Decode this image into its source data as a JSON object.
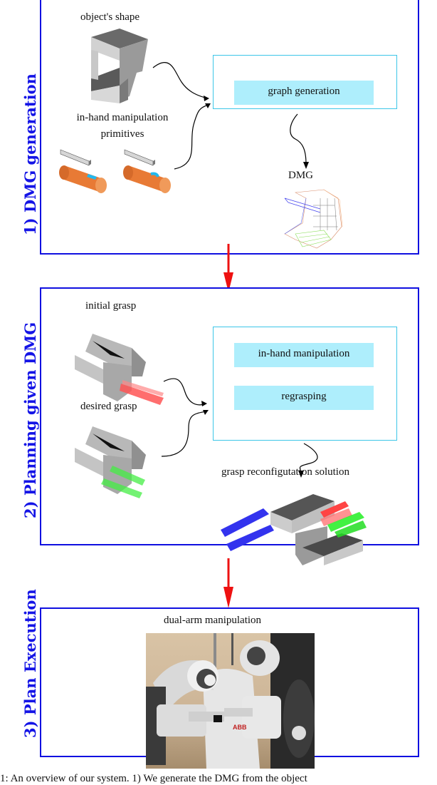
{
  "figure": {
    "stages": [
      {
        "label": "1) DMG generation",
        "inputs": [
          {
            "label": "object's shape"
          },
          {
            "label_line1": "in-hand manipulation",
            "label_line2": "primitives"
          }
        ],
        "process_boxes": [
          "graph generation"
        ],
        "output": {
          "label": "DMG"
        }
      },
      {
        "label": "2) Planning given DMG",
        "inputs": [
          {
            "label": "initial grasp"
          },
          {
            "label": "desired grasp"
          }
        ],
        "process_boxes": [
          "in-hand manipulation",
          "regrasping"
        ],
        "output": {
          "label": "grasp reconfigutation solution"
        }
      },
      {
        "label": "3)  Plan Execution",
        "output": {
          "label": "dual-arm manipulation",
          "photo_text": "ABB"
        }
      }
    ],
    "caption_fragment": "1: An overview of our system. 1) We generate the DMG from the object"
  },
  "colors": {
    "panel_border": "#1010e0",
    "stage_label": "#1414e6",
    "process_frame": "#3cc6e8",
    "process_fill": "#aeeefc",
    "flow_arrow": "#ee1111",
    "cylinder": "#e87a35",
    "motion_arrow": "#22b8ee",
    "initial_finger": "#ff4444",
    "desired_finger": "#44ee44",
    "solution_finger": "#3333ee"
  }
}
